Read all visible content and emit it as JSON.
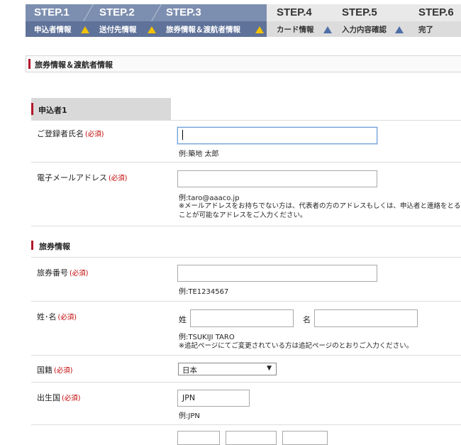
{
  "steps": [
    {
      "num": "STEP.1",
      "label": "申込者情報",
      "state": "done"
    },
    {
      "num": "STEP.2",
      "label": "送付先情報",
      "state": "done"
    },
    {
      "num": "STEP.3",
      "label": "旅券情報＆渡航者情報",
      "state": "current"
    },
    {
      "num": "STEP.4",
      "label": "カード情報",
      "state": "todo"
    },
    {
      "num": "STEP.5",
      "label": "入力内容確認",
      "state": "todo"
    },
    {
      "num": "STEP.6",
      "label": "完了",
      "state": "todo"
    }
  ],
  "section_title": "旅券情報＆渡航者情報",
  "applicant_heading": "申込者1",
  "required_mark": "(必須)",
  "fields": {
    "name": {
      "label": "ご登録者氏名",
      "value": "",
      "example": "例:築地 太郎"
    },
    "email": {
      "label": "電子メールアドレス",
      "value": "",
      "example": "例:taro@aaaco.jp",
      "note": "※メールアドレスをお持ちでない方は、代表者の方のアドレスもしくは、申込者と連絡をとることが可能なアドレスをご入力ください。"
    },
    "passport_no": {
      "label": "旅券番号",
      "value": "",
      "example": "例:TE1234567"
    },
    "fullname": {
      "label": "姓･名",
      "last_label": "姓",
      "first_label": "名",
      "last_value": "",
      "first_value": "",
      "example": "例:TSUKIJI TARO",
      "note": "※追記ページにてご変更されている方は追記ページのとおりご入力ください。"
    },
    "nationality": {
      "label": "国籍",
      "selected": "日本"
    },
    "birth_country": {
      "label": "出生国",
      "value": "JPN",
      "example": "例:JPN"
    }
  },
  "passport_heading": "旅券情報"
}
